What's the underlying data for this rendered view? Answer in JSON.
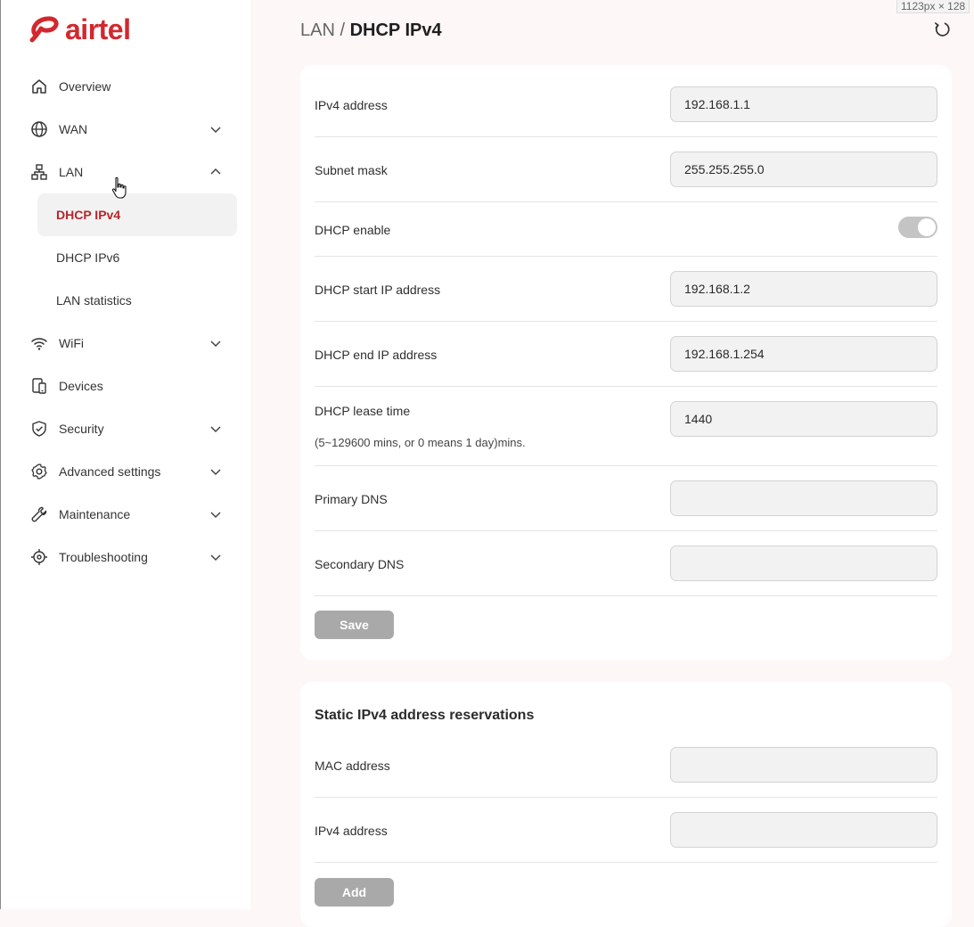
{
  "brand": {
    "name": "airtel",
    "color": "#d2282e"
  },
  "window": {
    "size_label": "1123px × 128"
  },
  "breadcrumb": {
    "parent": "LAN",
    "separator": " / ",
    "current": "DHCP IPv4"
  },
  "sidebar": {
    "items": [
      {
        "label": "Overview",
        "icon": "home-icon",
        "chevron": false
      },
      {
        "label": "WAN",
        "icon": "globe-icon",
        "chevron": "down"
      },
      {
        "label": "LAN",
        "icon": "network-icon",
        "chevron": "up"
      },
      {
        "label": "WiFi",
        "icon": "wifi-icon",
        "chevron": "down"
      },
      {
        "label": "Devices",
        "icon": "devices-icon",
        "chevron": false
      },
      {
        "label": "Security",
        "icon": "shield-icon",
        "chevron": "down"
      },
      {
        "label": "Advanced settings",
        "icon": "gear-icon",
        "chevron": "down"
      },
      {
        "label": "Maintenance",
        "icon": "wrench-icon",
        "chevron": "down"
      },
      {
        "label": "Troubleshooting",
        "icon": "crosshair-icon",
        "chevron": "down"
      }
    ],
    "lan_subitems": [
      {
        "label": "DHCP IPv4",
        "active": true
      },
      {
        "label": "DHCP IPv6",
        "active": false
      },
      {
        "label": "LAN statistics",
        "active": false
      }
    ]
  },
  "dhcp_form": {
    "ipv4_address": {
      "label": "IPv4 address",
      "value": "192.168.1.1"
    },
    "subnet_mask": {
      "label": "Subnet mask",
      "value": "255.255.255.0"
    },
    "dhcp_enable": {
      "label": "DHCP enable",
      "on": true
    },
    "start_ip": {
      "label": "DHCP start IP address",
      "value": "192.168.1.2"
    },
    "end_ip": {
      "label": "DHCP end IP address",
      "value": "192.168.1.254"
    },
    "lease_time": {
      "label": "DHCP lease time",
      "hint": "(5~129600 mins, or 0 means 1 day)mins.",
      "value": "1440"
    },
    "primary_dns": {
      "label": "Primary DNS",
      "value": ""
    },
    "secondary_dns": {
      "label": "Secondary DNS",
      "value": ""
    },
    "save_label": "Save"
  },
  "reservations": {
    "title": "Static IPv4 address reservations",
    "mac_address": {
      "label": "MAC address",
      "value": ""
    },
    "ipv4_address": {
      "label": "IPv4 address",
      "value": ""
    },
    "add_label": "Add"
  },
  "colors": {
    "active_text": "#b5262c",
    "button_disabled": "#a9a9a9",
    "toggle_track": "#c4c4c4"
  }
}
